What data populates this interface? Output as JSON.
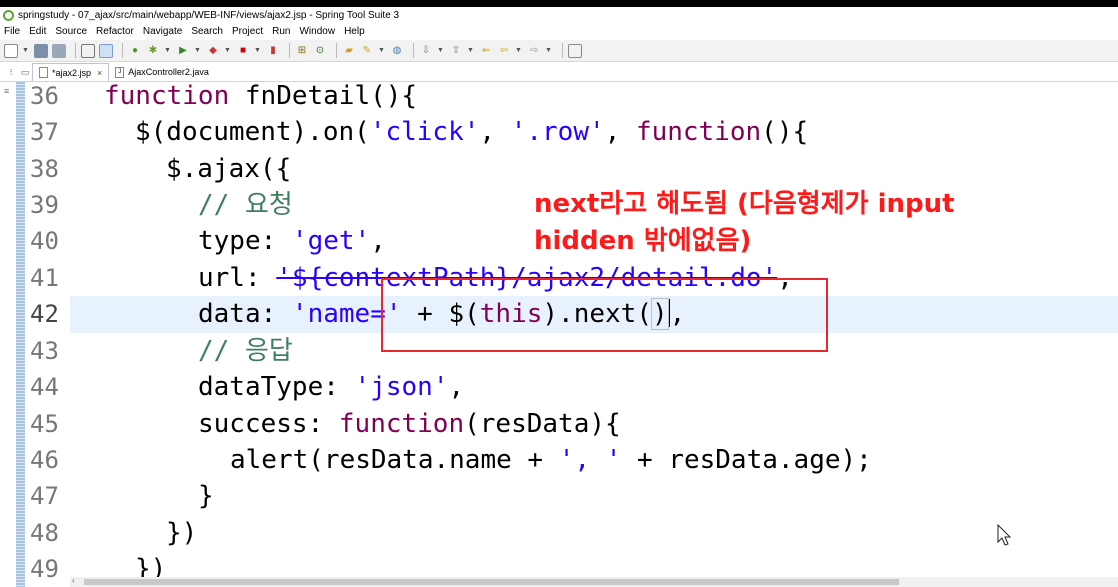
{
  "window": {
    "title": "springstudy - 07_ajax/src/main/webapp/WEB-INF/views/ajax2.jsp - Spring Tool Suite 3"
  },
  "menu": {
    "items": [
      "File",
      "Edit",
      "Source",
      "Refactor",
      "Navigate",
      "Search",
      "Project",
      "Run",
      "Window",
      "Help"
    ]
  },
  "toolbar": {
    "icons": [
      "new-icon",
      "save-icon",
      "save-all-icon",
      "print-icon",
      "toggle-mark-occurrences-icon",
      "spring-icon",
      "debug-icon",
      "run-icon",
      "coverage-icon",
      "stop-icon",
      "server-icon",
      "open-type-icon",
      "search-icon",
      "next-annotation-icon",
      "back-icon",
      "forward-icon",
      "open-perspective-icon"
    ]
  },
  "tabs": [
    {
      "label": "*ajax2.jsp",
      "active": true
    },
    {
      "label": "AjaxController2.java",
      "active": false
    }
  ],
  "editor": {
    "lines": [
      {
        "num": "36"
      },
      {
        "num": "37"
      },
      {
        "num": "38"
      },
      {
        "num": "39"
      },
      {
        "num": "40"
      },
      {
        "num": "41"
      },
      {
        "num": "42",
        "current": true
      },
      {
        "num": "43"
      },
      {
        "num": "44"
      },
      {
        "num": "45"
      },
      {
        "num": "46"
      },
      {
        "num": "47"
      },
      {
        "num": "48"
      },
      {
        "num": "49"
      }
    ],
    "tokens": {
      "l36": {
        "kw": "function",
        "rest": " fnDetail(){"
      },
      "l37": {
        "a": "$(document).on(",
        "s1": "'click'",
        "b": ", ",
        "s2": "'.row'",
        "c": ", ",
        "kw": "function",
        "d": "(){"
      },
      "l38": {
        "a": "$.ajax({"
      },
      "l39": {
        "cm": "// 요청"
      },
      "l40": {
        "a": "type: ",
        "s": "'get'",
        "b": ","
      },
      "l41": {
        "a": "url: ",
        "s": "'${contextPath}/ajax2/detail.do'",
        "b": ","
      },
      "l42": {
        "a": "data: ",
        "s": "'name='",
        "b": " + $(",
        "kw": "this",
        "c": ").next(",
        "d": ")",
        "e": ","
      },
      "l43": {
        "cm": "// 응답"
      },
      "l44": {
        "a": "dataType: ",
        "s": "'json'",
        "b": ","
      },
      "l45": {
        "a": "success: ",
        "kw": "function",
        "b": "(resData){"
      },
      "l46": {
        "a": "alert(resData.name + ",
        "s": "', '",
        "b": " + resData.age);"
      },
      "l47": {
        "a": "}"
      },
      "l48": {
        "a": "})"
      },
      "l49": {
        "a": "})"
      }
    }
  },
  "annotation": {
    "line1": "next라고 해도됨 (다음형제가 input",
    "line2": "hidden 밖에없음)",
    "color": "#ff1a1a",
    "box_color": "#e8262d"
  },
  "colors": {
    "keyword": "#7f0055",
    "string": "#2a00ff",
    "comment": "#3f7f5f",
    "current_line": "#e8f2fe"
  }
}
